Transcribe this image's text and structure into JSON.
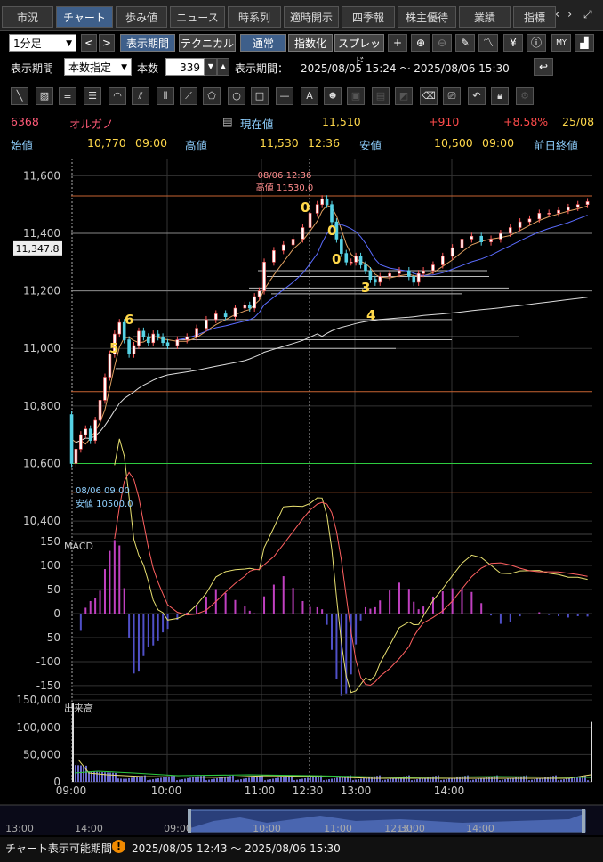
{
  "tabs": [
    {
      "label": "市況",
      "active": false
    },
    {
      "label": "チャート",
      "active": true
    },
    {
      "label": "歩み値",
      "active": false
    },
    {
      "label": "ニュース",
      "active": false
    },
    {
      "label": "時系列",
      "active": false
    },
    {
      "label": "適時開示",
      "active": false
    },
    {
      "label": "四季報",
      "active": false
    },
    {
      "label": "株主優待",
      "active": false
    },
    {
      "label": "業績",
      "active": false
    },
    {
      "label": "指標",
      "active": false
    }
  ],
  "toolbar": {
    "interval": "1分足",
    "display_period_button": "表示期間",
    "technical_button": "テクニカル",
    "normal_button": "通常",
    "index_button": "指数化",
    "spread_button": "スプレッド"
  },
  "period": {
    "label": "表示期間",
    "mode": "本数指定",
    "count_label": "本数",
    "count": "339",
    "range_label": "表示期間：",
    "range": "2025/08/05 15:24 〜 2025/08/06 15:30"
  },
  "stock": {
    "code": "6368",
    "name": "オルガノ",
    "current_label": "現在値",
    "current": "11,510",
    "change": "+910",
    "change_pct": "+8.58%",
    "date": "25/08",
    "open_label": "始値",
    "open": "10,770",
    "open_time": "09:00",
    "high_label": "高値",
    "high": "11,530",
    "high_time": "12:36",
    "low_label": "安値",
    "low": "10,500",
    "low_time": "09:00",
    "prev_close_label": "前日終値"
  },
  "chart_data": {
    "type": "candlestick",
    "price_yticks": [
      10400,
      10600,
      10800,
      11000,
      11200,
      11400,
      11600
    ],
    "price_ylim": [
      10360,
      11660
    ],
    "current_price_label": "11,347.8",
    "high_annotation": {
      "time": "08/06 12:36",
      "text": "高値 11530.0"
    },
    "low_annotation": {
      "time": "08/06 09:00",
      "text": "安値 10500.0"
    },
    "count_labels": [
      "5",
      "6",
      "0",
      "0",
      "0",
      "3",
      "4"
    ],
    "x_ticks": [
      "09:00",
      "10:00",
      "11:00",
      "12:30",
      "13:00",
      "14:00"
    ],
    "price_path": [
      [
        0,
        10770
      ],
      [
        0.2,
        10600
      ],
      [
        2,
        10650
      ],
      [
        4,
        10700
      ],
      [
        6,
        10720
      ],
      [
        8,
        10680
      ],
      [
        10,
        10750
      ],
      [
        12,
        10820
      ],
      [
        14,
        10900
      ],
      [
        16,
        10980
      ],
      [
        18,
        11050
      ],
      [
        20,
        11090
      ],
      [
        22,
        11030
      ],
      [
        24,
        10980
      ],
      [
        26,
        11010
      ],
      [
        28,
        11060
      ],
      [
        30,
        11040
      ],
      [
        32,
        11020
      ],
      [
        34,
        11050
      ],
      [
        36,
        11040
      ],
      [
        38,
        11020
      ],
      [
        40,
        11010
      ],
      [
        44,
        11030
      ],
      [
        48,
        11040
      ],
      [
        52,
        11070
      ],
      [
        56,
        11100
      ],
      [
        60,
        11120
      ],
      [
        64,
        11110
      ],
      [
        68,
        11140
      ],
      [
        72,
        11150
      ],
      [
        74,
        11140
      ],
      [
        76,
        11180
      ],
      [
        78,
        11200
      ],
      [
        80,
        11300
      ],
      [
        84,
        11340
      ],
      [
        88,
        11360
      ],
      [
        92,
        11380
      ],
      [
        96,
        11420
      ],
      [
        99,
        11470
      ],
      [
        102,
        11500
      ],
      [
        104,
        11520
      ],
      [
        106,
        11500
      ],
      [
        108,
        11440
      ],
      [
        110,
        11380
      ],
      [
        112,
        11330
      ],
      [
        114,
        11300
      ],
      [
        116,
        11300
      ],
      [
        118,
        11320
      ],
      [
        120,
        11290
      ],
      [
        122,
        11270
      ],
      [
        124,
        11240
      ],
      [
        126,
        11230
      ],
      [
        128,
        11250
      ],
      [
        132,
        11260
      ],
      [
        136,
        11270
      ],
      [
        140,
        11250
      ],
      [
        142,
        11230
      ],
      [
        144,
        11260
      ],
      [
        146,
        11270
      ],
      [
        150,
        11290
      ],
      [
        154,
        11320
      ],
      [
        158,
        11350
      ],
      [
        162,
        11380
      ],
      [
        166,
        11390
      ],
      [
        170,
        11370
      ],
      [
        174,
        11380
      ],
      [
        178,
        11400
      ],
      [
        182,
        11420
      ],
      [
        186,
        11440
      ],
      [
        190,
        11450
      ],
      [
        194,
        11470
      ],
      [
        198,
        11470
      ],
      [
        202,
        11480
      ],
      [
        206,
        11490
      ],
      [
        210,
        11500
      ],
      [
        214,
        11510
      ]
    ],
    "horizontal_levels": [
      11530,
      11400,
      11200,
      10850,
      10600,
      10500
    ],
    "macd": {
      "label": "MACD",
      "yticks": [
        150,
        100,
        50,
        0,
        -50,
        -100,
        -150
      ]
    },
    "volume": {
      "label": "出来高",
      "yticks": [
        150000,
        100000,
        50000,
        0
      ]
    }
  },
  "navigator": {
    "ticks": [
      "13:00",
      "14:00",
      "09:00",
      "10:00",
      "11:00",
      "12:30",
      "13:00",
      "14:00"
    ]
  },
  "footer": {
    "label": "チャート表示可能期間",
    "range": "2025/08/05 12:43 〜 2025/08/06 15:30"
  }
}
